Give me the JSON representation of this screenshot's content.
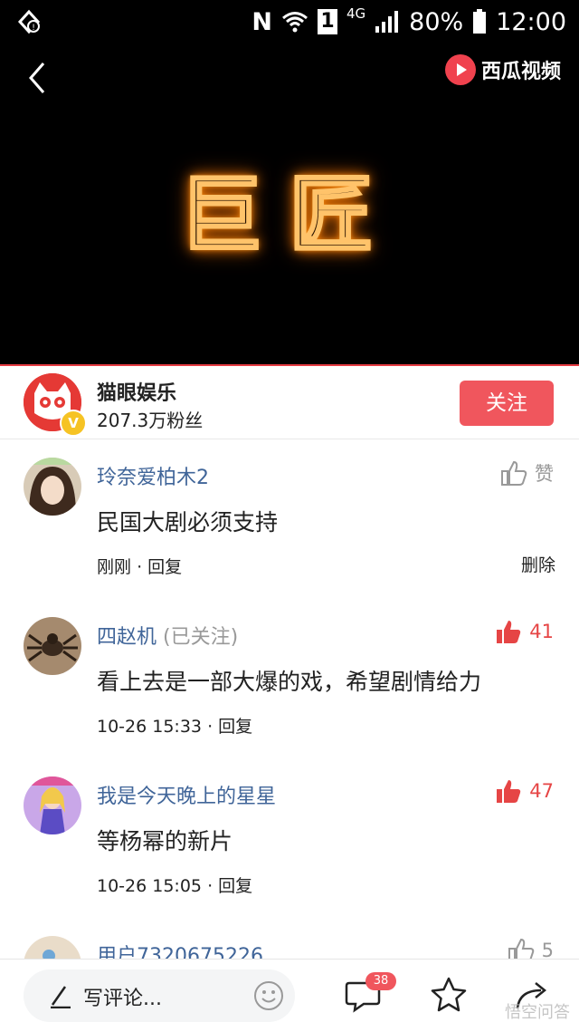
{
  "status_bar": {
    "network_n": "N",
    "sim": "1",
    "network_type": "4G",
    "battery": "80%",
    "time": "12:00"
  },
  "video": {
    "brand_name": "西瓜视频",
    "title_text": "巨匠"
  },
  "author": {
    "name": "猫眼娱乐",
    "fans": "207.3万粉丝",
    "verified_badge": "V",
    "follow_label": "关注"
  },
  "comments": [
    {
      "user": "玲奈爱柏木2",
      "text": "民国大剧必须支持",
      "time": "刚刚",
      "reply": "回复",
      "like_label": "赞",
      "liked": false,
      "delete_label": "删除"
    },
    {
      "user": "四赵机",
      "followed_tag": "(已关注)",
      "text": "看上去是一部大爆的戏，希望剧情给力",
      "time": "10-26 15:33",
      "reply": "回复",
      "likes": "41",
      "liked": true
    },
    {
      "user": "我是今天晚上的星星",
      "text": "等杨幂的新片",
      "time": "10-26 15:05",
      "reply": "回复",
      "likes": "47",
      "liked": true
    },
    {
      "user": "用户7320675226",
      "likes": "5",
      "liked": false
    }
  ],
  "bottom_bar": {
    "write_placeholder": "写评论...",
    "comment_count": "38"
  },
  "watermark": "悟空问答",
  "colors": {
    "accent_red": "#f0565d",
    "username_blue": "#406599"
  }
}
